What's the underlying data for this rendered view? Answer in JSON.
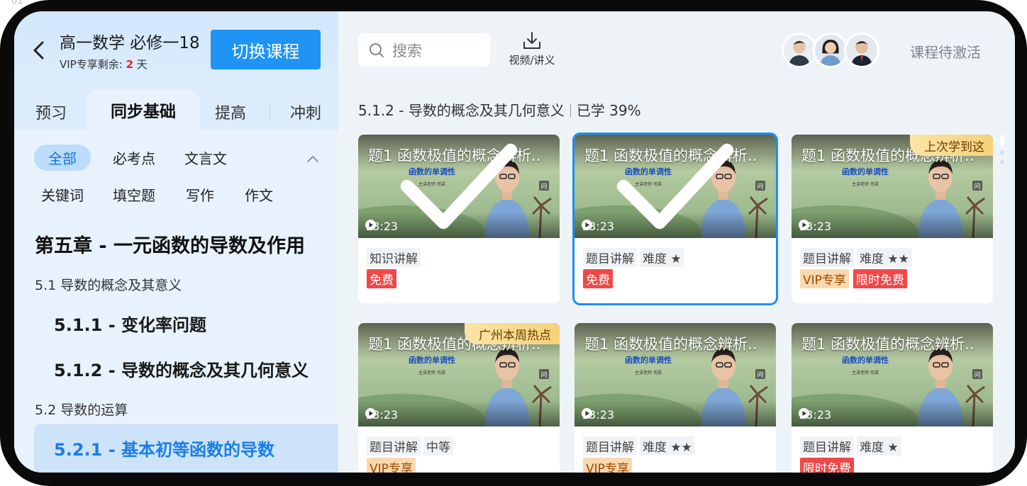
{
  "corner_text": "01",
  "sidebar": {
    "course_title": "高一数学 必修一18",
    "vip_label": "VIP专享剩余:",
    "vip_days": "2",
    "vip_unit": "天",
    "switch_label": "切换课程",
    "tabs": [
      "预习",
      "同步基础",
      "提高",
      "冲刺"
    ],
    "active_tab": "同步基础",
    "filters_row1": [
      "全部",
      "必考点",
      "文言文"
    ],
    "filters_row2": [
      "关键词",
      "填空题",
      "写作",
      "作文"
    ],
    "active_filter": "全部",
    "chapter": "第五章 - 一元函数的导数及作用",
    "sections": [
      {
        "title": "5.1 导数的概念及其意义",
        "lessons": [
          "5.1.1 - 变化率问题",
          "5.1.2 - 导数的概念及其几何意义"
        ]
      },
      {
        "title": "5.2 导数的运算",
        "lessons": [
          "5.2.1 - 基本初等函数的导数"
        ]
      }
    ],
    "active_lesson": "5.2.1 - 基本初等函数的导数"
  },
  "main": {
    "search_placeholder": "搜索",
    "download_label": "视频/讲义",
    "activate_label": "课程待激活",
    "progress_title": "5.1.2 - 导数的概念及其几何意义",
    "progress_status": "已学 39%",
    "progress_value": 0.39,
    "cards": [
      {
        "title": "题1 函数极值的概念辨析..",
        "subtitle": "函数的单调性",
        "teacher": "主讲老师  司梁",
        "duration": "13:23",
        "ribbon": "",
        "watched": true,
        "selected": false,
        "tags": [
          "知识讲解"
        ],
        "badges": [
          {
            "type": "free",
            "label": "免费"
          }
        ]
      },
      {
        "title": "题1 函数极值的概念辨析..",
        "subtitle": "函数的单调性",
        "teacher": "主讲老师  司梁",
        "duration": "13:23",
        "ribbon": "",
        "watched": true,
        "selected": true,
        "tags": [
          "题目讲解",
          "难度 ★"
        ],
        "badges": [
          {
            "type": "free",
            "label": "免费"
          }
        ]
      },
      {
        "title": "题1 函数极值的概念辨析..",
        "subtitle": "函数的单调性",
        "teacher": "主讲老师  司梁",
        "duration": "13:23",
        "ribbon": "上次学到这",
        "watched": false,
        "selected": false,
        "tags": [
          "题目讲解",
          "难度 ★★"
        ],
        "badges": [
          {
            "type": "vip",
            "label": "VIP专享"
          },
          {
            "type": "limited",
            "label": "限时免费"
          }
        ]
      },
      {
        "title": "题1 函数极值的概念辨析..",
        "subtitle": "函数的单调性",
        "teacher": "主讲老师  司梁",
        "duration": "13:23",
        "ribbon": "广州本周热点",
        "watched": false,
        "selected": false,
        "tags": [
          "题目讲解",
          "中等"
        ],
        "badges": [
          {
            "type": "vip",
            "label": "VIP专享"
          }
        ]
      },
      {
        "title": "题1 函数极值的概念辨析..",
        "subtitle": "函数的单调性",
        "teacher": "主讲老师  司梁",
        "duration": "13:23",
        "ribbon": "",
        "watched": false,
        "selected": false,
        "tags": [
          "题目讲解",
          "难度 ★★"
        ],
        "badges": [
          {
            "type": "vip",
            "label": "VIP专享"
          }
        ]
      },
      {
        "title": "题1 函数极值的概念辨析..",
        "subtitle": "函数的单调性",
        "teacher": "主讲老师  司梁",
        "duration": "13:23",
        "ribbon": "",
        "watched": false,
        "selected": false,
        "tags": [
          "题目讲解",
          "难度 ★"
        ],
        "badges": [
          {
            "type": "limited",
            "label": "限时免费"
          }
        ]
      }
    ]
  },
  "colors": {
    "accent": "#1f94f5",
    "free_badge": "#f04848",
    "vip_badge": "#fbd9b0",
    "ribbon": "#f5d27a",
    "sidebar": "#dcecfb"
  },
  "icons": [
    "back-icon",
    "search-icon",
    "download-icon",
    "play-icon",
    "check-icon",
    "chevron-up-icon",
    "teacher-avatar"
  ]
}
